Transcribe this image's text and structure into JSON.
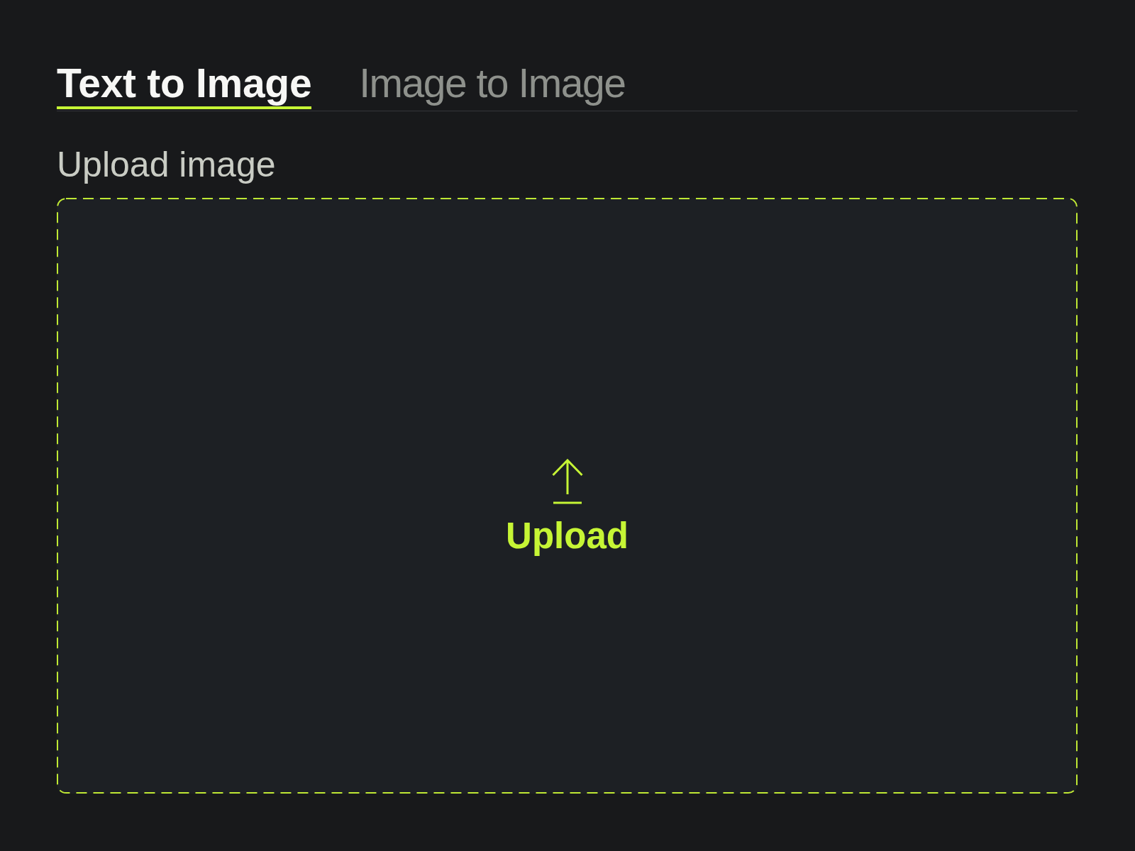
{
  "tabs": [
    {
      "label": "Text to Image",
      "selected": true
    },
    {
      "label": "Image to Image",
      "selected": false
    }
  ],
  "upload": {
    "label": "Upload image",
    "prompt": "Upload"
  }
}
